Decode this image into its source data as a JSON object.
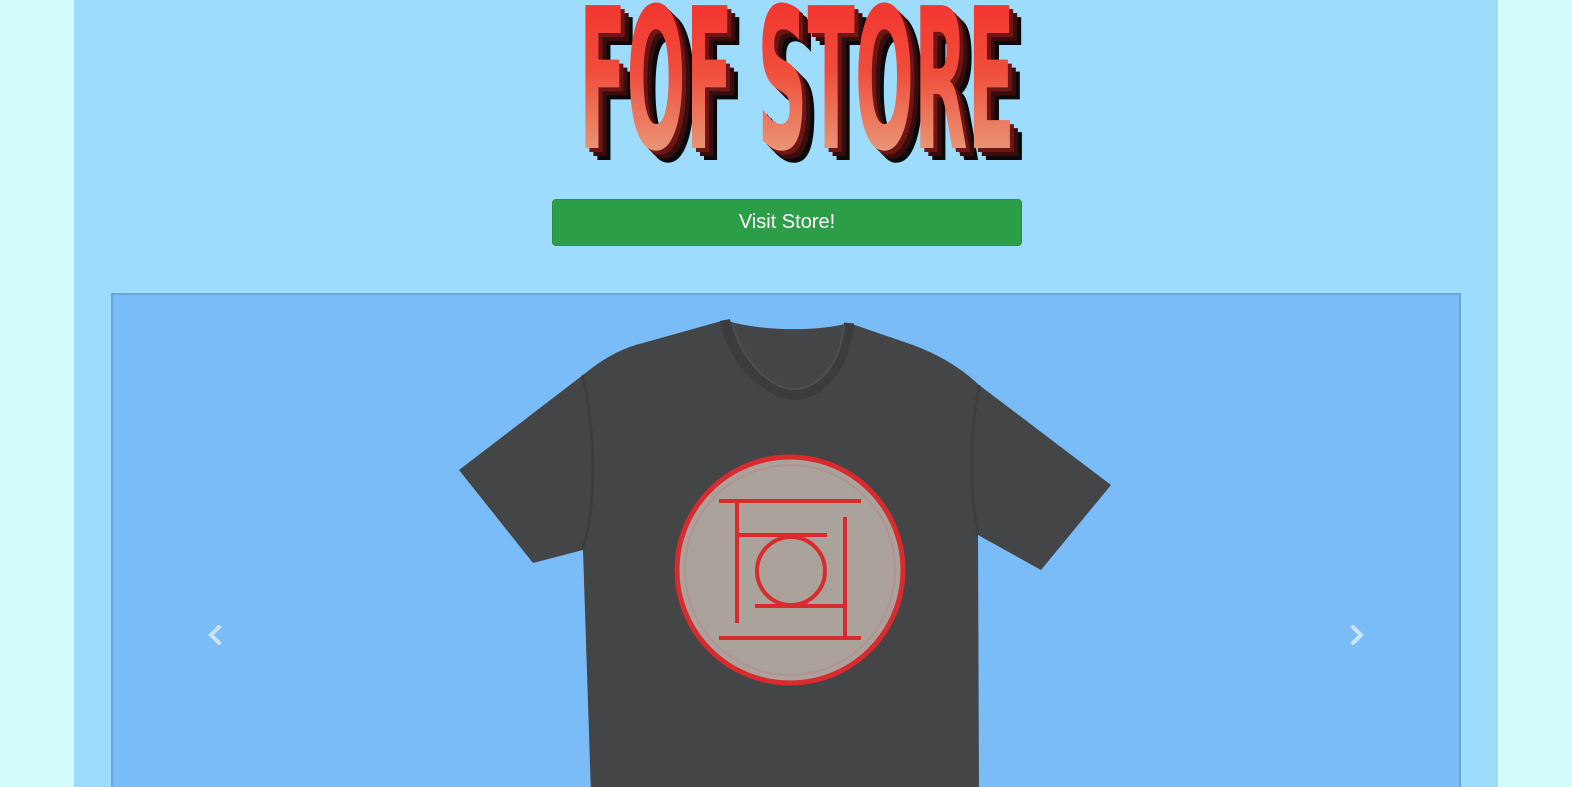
{
  "header": {
    "logo_text": "FOF STORE",
    "logo_alt": "FOF Store logo"
  },
  "actions": {
    "visit_store_label": "Visit Store!"
  },
  "carousel": {
    "slide_alt": "Dark grey t-shirt with red circular FOF emblem",
    "prev_icon": "chevron-left-icon",
    "next_icon": "chevron-right-icon"
  },
  "colors": {
    "outer_background": "#d2fbfc",
    "page_background": "#9ddcfc",
    "button_green": "#2c9e47",
    "carousel_background": "#7abcf8",
    "shirt": "#434547",
    "emblem_red": "#d92a2e",
    "emblem_fill": "#aba29c"
  }
}
